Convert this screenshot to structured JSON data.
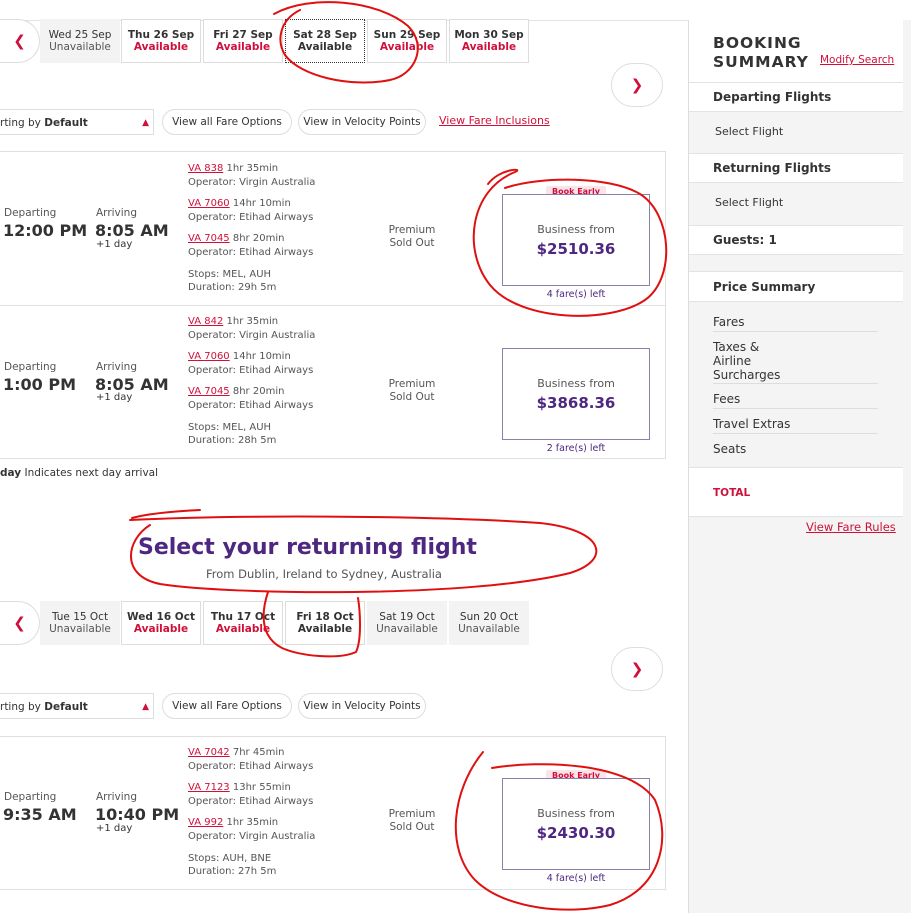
{
  "departing_dates": [
    {
      "day": "Wed 25 Sep",
      "status": "Unavailable"
    },
    {
      "day": "Thu 26 Sep",
      "status": "Available"
    },
    {
      "day": "Fri 27 Sep",
      "status": "Available"
    },
    {
      "day": "Sat 28 Sep",
      "status": "Available"
    },
    {
      "day": "Sun 29 Sep",
      "status": "Available"
    },
    {
      "day": "Mon 30 Sep",
      "status": "Available"
    }
  ],
  "returning_dates": [
    {
      "day": "Tue 15 Oct",
      "status": "Unavailable"
    },
    {
      "day": "Wed 16 Oct",
      "status": "Available"
    },
    {
      "day": "Thu 17 Oct",
      "status": "Available"
    },
    {
      "day": "Fri 18 Oct",
      "status": "Available"
    },
    {
      "day": "Sat 19 Oct",
      "status": "Unavailable"
    },
    {
      "day": "Sun 20 Oct",
      "status": "Unavailable"
    }
  ],
  "controls": {
    "sort_prefix": "rting by ",
    "sort_value": "Default",
    "all_fares": "View all Fare Options",
    "velocity": "View in Velocity Points",
    "inclusions": "View Fare Inclusions"
  },
  "labels": {
    "departing": "Departing",
    "arriving": "Arriving",
    "plus_day": "+1 day",
    "premium": "Premium",
    "sold_out": "Sold Out",
    "business_from": "Business from",
    "book_early": "Book Early"
  },
  "departing_flights": [
    {
      "dep": "12:00 PM",
      "arr": "8:05 AM",
      "segments": [
        {
          "flight": "VA 838",
          "dur": "1hr 35min",
          "op": "Operator: Virgin Australia"
        },
        {
          "flight": "VA 7060",
          "dur": "14hr 10min",
          "op": "Operator: Etihad Airways"
        },
        {
          "flight": "VA 7045",
          "dur": "8hr 20min",
          "op": "Operator: Etihad Airways"
        }
      ],
      "stops": "Stops: MEL, AUH",
      "duration": "Duration: 29h 5m",
      "price": "$2510.36",
      "fares_left": "4 fare(s) left"
    },
    {
      "dep": "1:00 PM",
      "arr": "8:05 AM",
      "segments": [
        {
          "flight": "VA 842",
          "dur": "1hr 35min",
          "op": "Operator: Virgin Australia"
        },
        {
          "flight": "VA 7060",
          "dur": "14hr 10min",
          "op": "Operator: Etihad Airways"
        },
        {
          "flight": "VA 7045",
          "dur": "8hr 20min",
          "op": "Operator: Etihad Airways"
        }
      ],
      "stops": "Stops: MEL, AUH",
      "duration": "Duration: 28h 5m",
      "price": "$3868.36",
      "fares_left": "2 fare(s) left"
    }
  ],
  "next_day_note": {
    "prefix": "day",
    "text": "Indicates next day arrival"
  },
  "returning_section": {
    "title": "Select your returning flight",
    "subtitle": "From Dublin, Ireland to Sydney, Australia"
  },
  "returning_flights": [
    {
      "dep": "9:35 AM",
      "arr": "10:40 PM",
      "segments": [
        {
          "flight": "VA 7042",
          "dur": "7hr 45min",
          "op": "Operator: Etihad Airways"
        },
        {
          "flight": "VA 7123",
          "dur": "13hr 55min",
          "op": "Operator: Etihad Airways"
        },
        {
          "flight": "VA 992",
          "dur": "1hr 35min",
          "op": "Operator: Virgin Australia"
        }
      ],
      "stops": "Stops: AUH, BNE",
      "duration": "Duration: 27h 5m",
      "price": "$2430.30",
      "fares_left": "4 fare(s) left"
    }
  ],
  "sidebar": {
    "title_line1": "BOOKING",
    "title_line2": "SUMMARY",
    "modify": "Modify Search",
    "departing": "Departing Flights",
    "select_dep": "Select Flight",
    "returning": "Returning Flights",
    "select_ret": "Select Flight",
    "guests": "Guests: 1",
    "price_summary": "Price Summary",
    "fares": "Fares",
    "taxes": [
      "Taxes &",
      "Airline",
      "Surcharges"
    ],
    "fees": "Fees",
    "extras": "Travel Extras",
    "seats": "Seats",
    "total": "TOTAL",
    "fare_rules": "View Fare Rules"
  },
  "colors": {
    "accent": "#d0103a",
    "brand": "#4e2780",
    "annotation": "#e01010"
  }
}
